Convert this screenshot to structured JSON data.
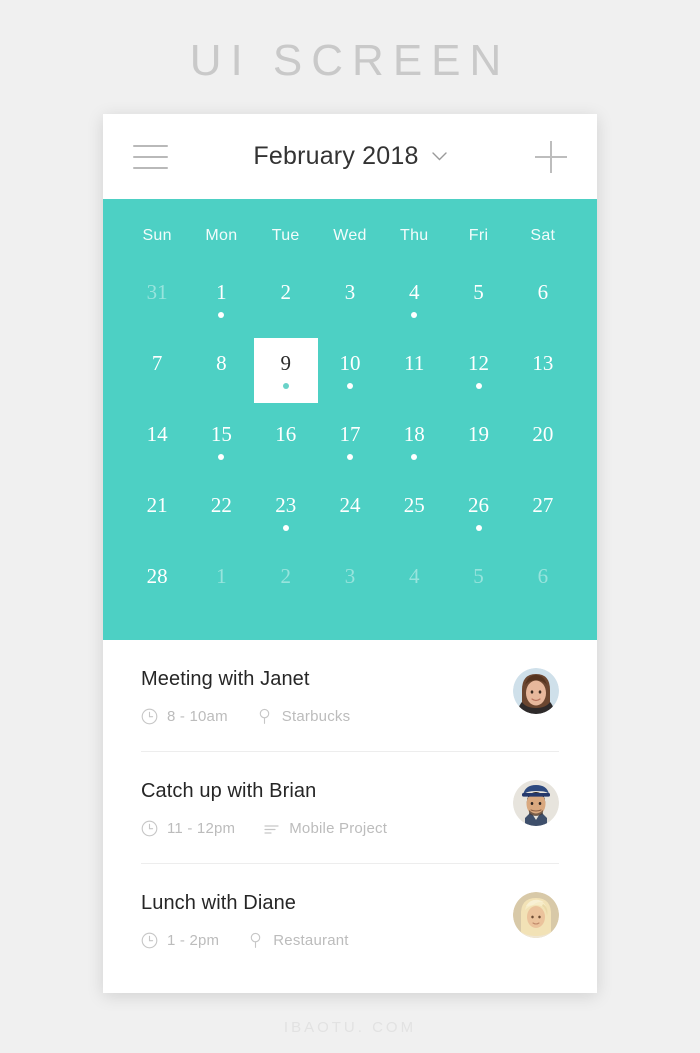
{
  "page": {
    "title": "UI SCREEN",
    "footer": "IBAOTU. COM"
  },
  "colors": {
    "accent": "#4dd0c4",
    "background": "#f0f0f0",
    "card": "#ffffff",
    "title_gray": "#c9c9c9",
    "selected_dot": "#69d2c8",
    "text_primary": "#262626",
    "text_muted": "#bcbcbc"
  },
  "header": {
    "menu_icon": "hamburger-icon",
    "title": "February 2018",
    "dropdown_icon": "chevron-down-icon",
    "add_icon": "plus-icon"
  },
  "calendar": {
    "weekdays": [
      "Sun",
      "Mon",
      "Tue",
      "Wed",
      "Thu",
      "Fri",
      "Sat"
    ],
    "weeks": [
      [
        {
          "day": "31",
          "muted": true,
          "dot": false,
          "selected": false
        },
        {
          "day": "1",
          "muted": false,
          "dot": true,
          "selected": false
        },
        {
          "day": "2",
          "muted": false,
          "dot": false,
          "selected": false
        },
        {
          "day": "3",
          "muted": false,
          "dot": false,
          "selected": false
        },
        {
          "day": "4",
          "muted": false,
          "dot": true,
          "selected": false
        },
        {
          "day": "5",
          "muted": false,
          "dot": false,
          "selected": false
        },
        {
          "day": "6",
          "muted": false,
          "dot": false,
          "selected": false
        }
      ],
      [
        {
          "day": "7",
          "muted": false,
          "dot": false,
          "selected": false
        },
        {
          "day": "8",
          "muted": false,
          "dot": false,
          "selected": false
        },
        {
          "day": "9",
          "muted": false,
          "dot": true,
          "selected": true
        },
        {
          "day": "10",
          "muted": false,
          "dot": true,
          "selected": false
        },
        {
          "day": "11",
          "muted": false,
          "dot": false,
          "selected": false
        },
        {
          "day": "12",
          "muted": false,
          "dot": true,
          "selected": false
        },
        {
          "day": "13",
          "muted": false,
          "dot": false,
          "selected": false
        }
      ],
      [
        {
          "day": "14",
          "muted": false,
          "dot": false,
          "selected": false
        },
        {
          "day": "15",
          "muted": false,
          "dot": true,
          "selected": false
        },
        {
          "day": "16",
          "muted": false,
          "dot": false,
          "selected": false
        },
        {
          "day": "17",
          "muted": false,
          "dot": true,
          "selected": false
        },
        {
          "day": "18",
          "muted": false,
          "dot": true,
          "selected": false
        },
        {
          "day": "19",
          "muted": false,
          "dot": false,
          "selected": false
        },
        {
          "day": "20",
          "muted": false,
          "dot": false,
          "selected": false
        }
      ],
      [
        {
          "day": "21",
          "muted": false,
          "dot": false,
          "selected": false
        },
        {
          "day": "22",
          "muted": false,
          "dot": false,
          "selected": false
        },
        {
          "day": "23",
          "muted": false,
          "dot": true,
          "selected": false
        },
        {
          "day": "24",
          "muted": false,
          "dot": false,
          "selected": false
        },
        {
          "day": "25",
          "muted": false,
          "dot": false,
          "selected": false
        },
        {
          "day": "26",
          "muted": false,
          "dot": true,
          "selected": false
        },
        {
          "day": "27",
          "muted": false,
          "dot": false,
          "selected": false
        }
      ],
      [
        {
          "day": "28",
          "muted": false,
          "dot": false,
          "selected": false
        },
        {
          "day": "1",
          "muted": true,
          "dot": false,
          "selected": false
        },
        {
          "day": "2",
          "muted": true,
          "dot": false,
          "selected": false
        },
        {
          "day": "3",
          "muted": true,
          "dot": false,
          "selected": false
        },
        {
          "day": "4",
          "muted": true,
          "dot": false,
          "selected": false
        },
        {
          "day": "5",
          "muted": true,
          "dot": false,
          "selected": false
        },
        {
          "day": "6",
          "muted": true,
          "dot": false,
          "selected": false
        }
      ]
    ]
  },
  "events": [
    {
      "title": "Meeting with Janet",
      "time": "8 - 10am",
      "time_icon": "clock-icon",
      "detail": "Starbucks",
      "detail_icon": "location-pin-icon",
      "avatar": "avatar-janet"
    },
    {
      "title": "Catch up with Brian",
      "time": "11 - 12pm",
      "time_icon": "clock-icon",
      "detail": "Mobile Project",
      "detail_icon": "list-lines-icon",
      "avatar": "avatar-brian"
    },
    {
      "title": "Lunch with Diane",
      "time": "1 - 2pm",
      "time_icon": "clock-icon",
      "detail": "Restaurant",
      "detail_icon": "location-pin-icon",
      "avatar": "avatar-diane"
    }
  ]
}
